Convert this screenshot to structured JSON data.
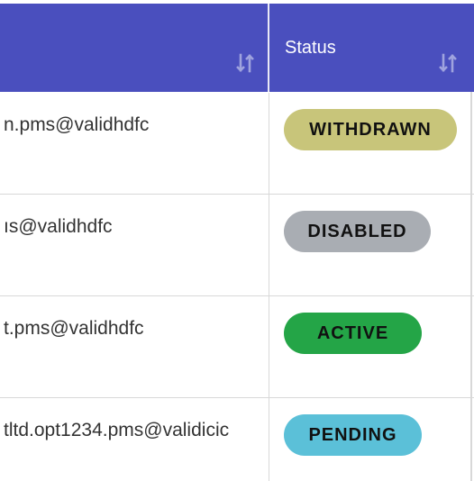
{
  "table": {
    "columns": [
      {
        "label": "",
        "sort_icon": "sort-arrows-icon"
      },
      {
        "label": "Status",
        "sort_icon": "sort-arrows-icon"
      }
    ],
    "rows": [
      {
        "email": "n.pms@validhdfc",
        "status": "WITHDRAWN",
        "status_color": "#c8c57a"
      },
      {
        "email": "ıs@validhdfc",
        "status": "DISABLED",
        "status_color": "#a9adb3"
      },
      {
        "email": "t.pms@validhdfc",
        "status": "ACTIVE",
        "status_color": "#24a547"
      },
      {
        "email": "tltd.opt1234.pms@validicic",
        "status": "PENDING",
        "status_color": "#5bc0d8"
      }
    ]
  },
  "colors": {
    "header_bg": "#4a4fbe",
    "header_text": "#ffffff"
  }
}
